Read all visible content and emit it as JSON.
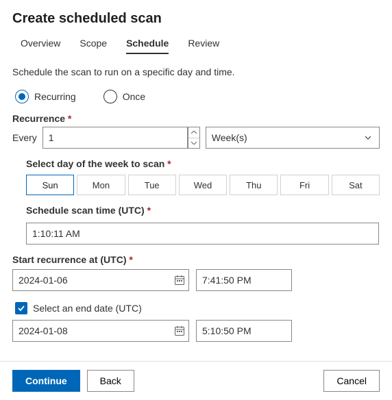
{
  "title": "Create scheduled scan",
  "tabs": [
    "Overview",
    "Scope",
    "Schedule",
    "Review"
  ],
  "active_tab": "Schedule",
  "description": "Schedule the scan to run on a specific day and time.",
  "frequency": {
    "options": [
      "Recurring",
      "Once"
    ],
    "selected": "Recurring"
  },
  "recurrence": {
    "label": "Recurrence",
    "every_label": "Every",
    "every_value": "1",
    "unit": "Week(s)"
  },
  "day_select": {
    "label": "Select day of the week to scan",
    "days": [
      "Sun",
      "Mon",
      "Tue",
      "Wed",
      "Thu",
      "Fri",
      "Sat"
    ],
    "selected": "Sun"
  },
  "scan_time": {
    "label": "Schedule scan time (UTC)",
    "value": "1:10:11 AM"
  },
  "start": {
    "label": "Start recurrence at (UTC)",
    "date": "2024-01-06",
    "time": "7:41:50 PM"
  },
  "end": {
    "checkbox_label": "Select an end date (UTC)",
    "checked": true,
    "date": "2024-01-08",
    "time": "5:10:50 PM"
  },
  "buttons": {
    "continue": "Continue",
    "back": "Back",
    "cancel": "Cancel"
  }
}
